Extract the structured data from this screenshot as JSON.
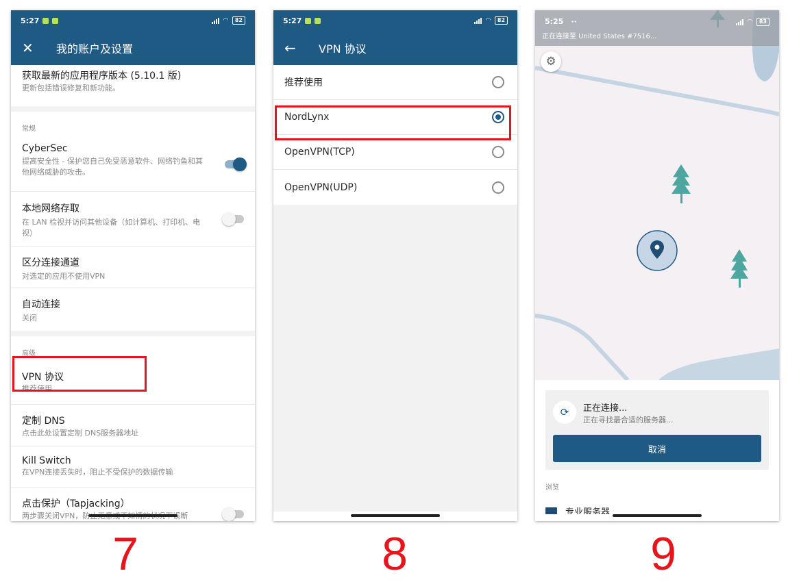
{
  "screens": [
    {
      "status": {
        "time": "5:27",
        "battery": "82"
      },
      "header_title": "我的账户及设置",
      "update": {
        "title": "获取最新的应用程序版本 (5.10.1 版)",
        "subtitle": "更新包括错误修复和新功能。"
      },
      "section_general": "常规",
      "general_items": [
        {
          "title": "CyberSec",
          "subtitle": "提高安全性 - 保护您自己免受恶意软件、网络钓鱼和其他网络威胁的攻击。",
          "toggle": "on"
        },
        {
          "title": "本地网络存取",
          "subtitle": "在 LAN 检视并访问其他设备（如计算机、打印机、电视）",
          "toggle": "off"
        },
        {
          "title": "区分连接通道",
          "subtitle": "对选定的应用不使用VPN"
        },
        {
          "title": "自动连接",
          "subtitle": "关闭"
        }
      ],
      "section_advanced": "高级",
      "advanced_items": [
        {
          "title": "VPN 协议",
          "subtitle": "推荐使用"
        },
        {
          "title": "定制 DNS",
          "subtitle": "点击此处设置定制 DNS服务器地址"
        },
        {
          "title": "Kill Switch",
          "subtitle": "在VPN连接丢失时，阻止不受保护的数据传输"
        },
        {
          "title": "点击保护（Tapjacking）",
          "subtitle": "两步骤关闭VPN，防止无意或不知情的状况下误断"
        }
      ]
    },
    {
      "status": {
        "time": "5:27",
        "battery": "82"
      },
      "header_title": "VPN 协议",
      "options": [
        "推荐使用",
        "NordLynx",
        "OpenVPN(TCP)",
        "OpenVPN(UDP)"
      ],
      "selected_option": "NordLynx"
    },
    {
      "status": {
        "time": "5:25",
        "battery": "83"
      },
      "connecting_banner": "正在连接至 United States #7516...",
      "card": {
        "title": "正在连接...",
        "subtitle": "正在寻找最合适的服务器...",
        "cancel_label": "取消"
      },
      "browse_label": "浏览",
      "partial_item": "专业服务器"
    }
  ],
  "captions": [
    "7",
    "8",
    "9"
  ],
  "colors": {
    "brand": "#1f5a84",
    "highlight": "#e0151f",
    "tree": "#4ea6a0"
  }
}
